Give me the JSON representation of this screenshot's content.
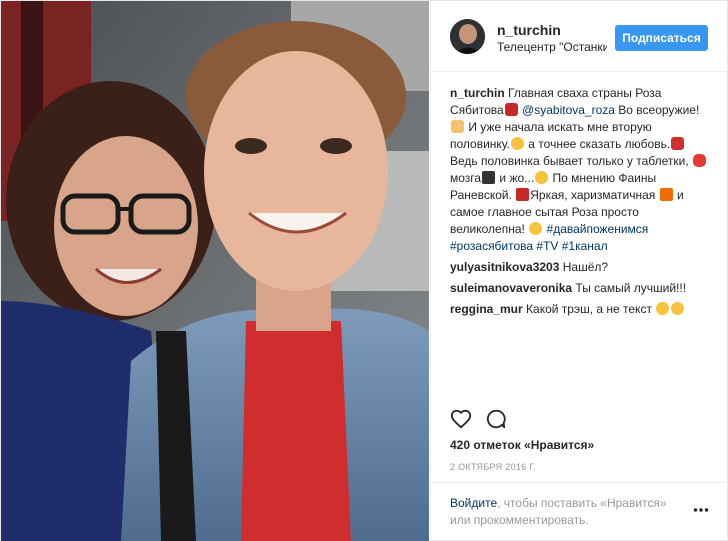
{
  "post": {
    "username": "n_turchin",
    "location": "Телецентр \"Останкино\"",
    "follow_label": "Подписаться"
  },
  "caption": {
    "username": "n_turchin",
    "t1": "Главная сваха страны Роза Сябитова",
    "mention": "@syabitova_roza",
    "t2": "Во всеоружие!",
    "t3": "И уже начала искать мне вторую половинку.",
    "t4": "а точнее сказать любовь.",
    "t5": "Ведь половинка бывает только у таблетки,",
    "t6": "мозга",
    "t7": "и жо...",
    "t8": "По мнению Фаины Раневской.",
    "t9": "Яркая, харизматичная",
    "t10": "и самое главное сытая Роза просто великолепна!",
    "hashtags": "#давайпоженимся #розасябитова #TV #1канал"
  },
  "comments": [
    {
      "user": "yulyasitnikova3203",
      "text": "Нашёл?"
    },
    {
      "user": "suleimanovaveronika",
      "text": "Ты самый лучший!!!"
    },
    {
      "user": "reggina_mur",
      "text": "Какой трэш, а не текст"
    }
  ],
  "likes_text": "420 отметок «Нравится»",
  "date_text": "2 ОКТЯБРЯ 2016 Г.",
  "login": {
    "link": "Войдите",
    "text": ", чтобы поставить «Нравится» или прокомментировать."
  },
  "icons": {
    "like": "heart-icon",
    "comment": "comment-bubble-icon",
    "more": "more-options-icon"
  },
  "colors": {
    "follow_button": "#3897f0",
    "link": "#003569",
    "muted": "#999999"
  }
}
